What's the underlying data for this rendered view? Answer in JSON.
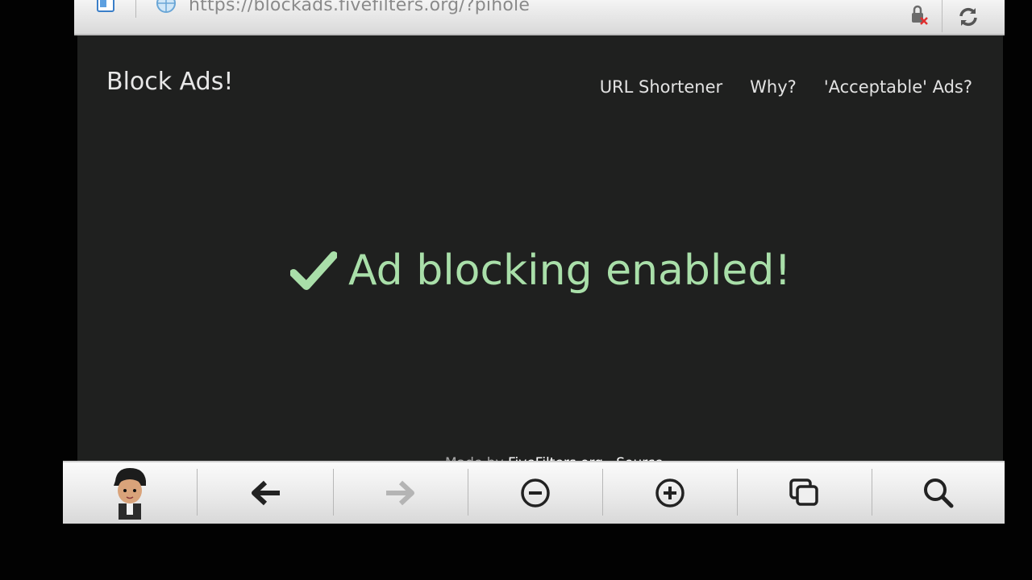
{
  "browser": {
    "url": "https://blockads.fivefilters.org/?pihole",
    "icons": {
      "tab": "tab-icon",
      "globe": "globe-icon",
      "lock": "lock-icon",
      "reload": "reload-icon"
    }
  },
  "site": {
    "title": "Block Ads!",
    "nav": {
      "url_shortener": "URL Shortener",
      "why": "Why?",
      "acceptable_ads": "'Acceptable' Ads?"
    },
    "status": {
      "text": "Ad blocking enabled!",
      "icon": "check-icon",
      "color": "#a9dfa9"
    },
    "footer": {
      "prefix": "Made by",
      "link1": "FiveFilters.org",
      "separator": "·",
      "link2": "Source"
    }
  },
  "toolbar": {
    "items": [
      "avatar",
      "back-icon",
      "forward-icon",
      "zoom-out-icon",
      "zoom-in-icon",
      "tabs-icon",
      "search-icon"
    ]
  }
}
